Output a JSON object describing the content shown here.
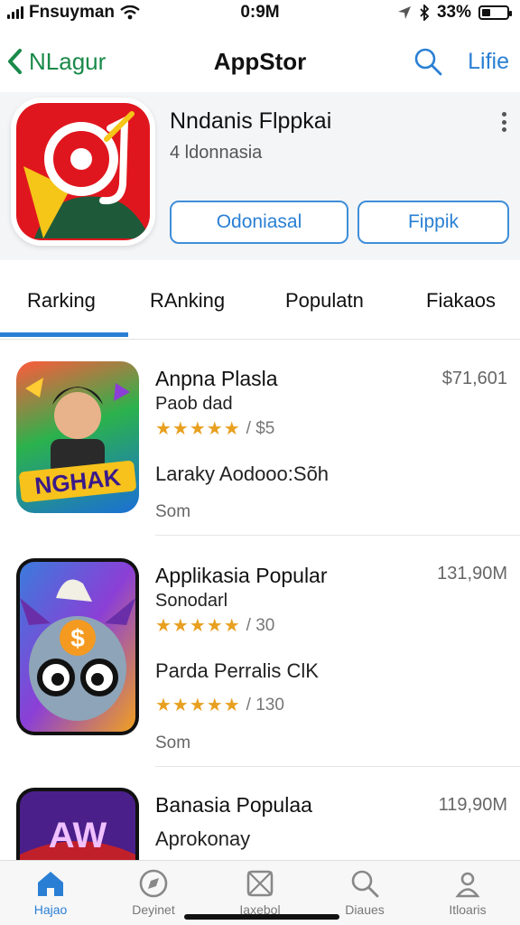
{
  "status": {
    "carrier": "Fnsuyman",
    "time": "0:9M",
    "battery": "33%",
    "battery_level": 0.33
  },
  "nav": {
    "back_label": "NLagur",
    "title": "AppStor",
    "action_label": "Lifie"
  },
  "header": {
    "app_name": "Nndanis Flppkai",
    "app_sub": "4 ldonnasia",
    "button_primary": "Odoniasal",
    "button_secondary": "Fippik"
  },
  "tabs": [
    {
      "label": "Rarking"
    },
    {
      "label": "RAnking"
    },
    {
      "label": "Populatn"
    },
    {
      "label": "Fiakaos"
    }
  ],
  "list": [
    {
      "name": "Anpna Plasla",
      "subtitle": "Paob dad",
      "stars": "★★★★★",
      "rating_count": "/ $5",
      "line3": "Laraky Aodooo:Sõh",
      "line4": "Som",
      "meta": "$71,601",
      "icon_text": "NGHAK"
    },
    {
      "name": "Applikasia Popular",
      "subtitle": "Sonodarl",
      "stars": "★★★★★",
      "rating_count": "/ 30",
      "line3": "Parda Perralis ClK",
      "stars2": "★★★★★",
      "rating_count2": "/ 130",
      "line4": "Som",
      "meta": "131,90M",
      "icon_text": "$"
    },
    {
      "name": "Banasia Populaa",
      "subtitle": "Aprokonay",
      "meta": "119,90M",
      "icon_text": "AW"
    }
  ],
  "tabbar": [
    {
      "label": "Hajao",
      "icon": "home-icon"
    },
    {
      "label": "Deyinet",
      "icon": "compass-icon"
    },
    {
      "label": "Iaxebol",
      "icon": "box-icon"
    },
    {
      "label": "Diaues",
      "icon": "search-icon"
    },
    {
      "label": "Itloaris",
      "icon": "person-icon"
    }
  ],
  "colors": {
    "accent": "#2a7fd4",
    "back": "#1a8a4a",
    "star": "#e8a020"
  }
}
